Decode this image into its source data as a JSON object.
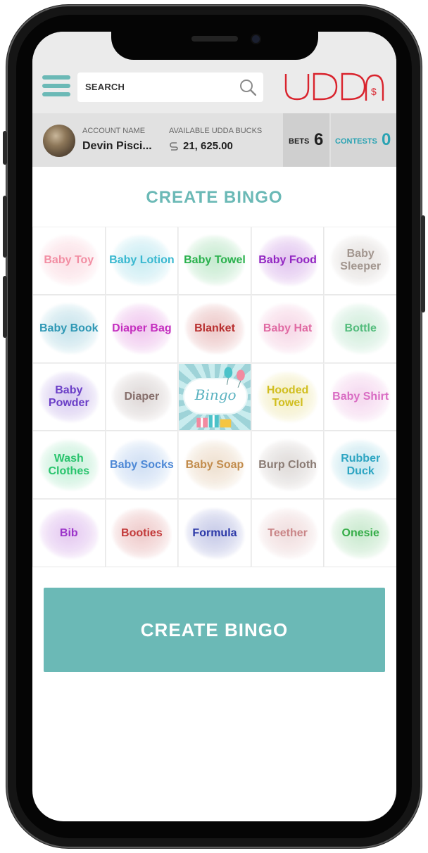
{
  "header": {
    "search_placeholder": "SEARCH",
    "logo_text": "UDDA",
    "logo_symbol": "$"
  },
  "account": {
    "name_label": "ACCOUNT NAME",
    "name": "Devin Pisci...",
    "bucks_label": "AVAILABLE UDDA BUCKS",
    "bucks_value": "21, 625.00",
    "bets_label": "BETS",
    "bets_count": "6",
    "contests_label": "CONTESTS",
    "contests_count": "0"
  },
  "page": {
    "title": "CREATE BINGO",
    "button_label": "CREATE BINGO"
  },
  "bingo": {
    "free_text": "Bingo",
    "cells": [
      {
        "label": "Baby Toy",
        "color": "#f28ea3"
      },
      {
        "label": "Baby Lotion",
        "color": "#39b8d0"
      },
      {
        "label": "Baby Towel",
        "color": "#2ab14d"
      },
      {
        "label": "Baby Food",
        "color": "#9226c2"
      },
      {
        "label": "Baby Sleeper",
        "color": "#a2968f"
      },
      {
        "label": "Baby Book",
        "color": "#2f98b5"
      },
      {
        "label": "Diaper Bag",
        "color": "#c42ebf"
      },
      {
        "label": "Blanket",
        "color": "#b82f2f"
      },
      {
        "label": "Baby Hat",
        "color": "#e06aa3"
      },
      {
        "label": "Bottle",
        "color": "#53bc7c"
      },
      {
        "label": "Baby Powder",
        "color": "#6b3fc7"
      },
      {
        "label": "Diaper",
        "color": "#866f6c"
      },
      {
        "label": "Bingo",
        "color": "#5ab2c0"
      },
      {
        "label": "Hooded Towel",
        "color": "#d1be1f"
      },
      {
        "label": "Baby Shirt",
        "color": "#d96cc3"
      },
      {
        "label": "Wash Clothes",
        "color": "#29c46d"
      },
      {
        "label": "Baby Socks",
        "color": "#4d88d6"
      },
      {
        "label": "Baby Soap",
        "color": "#c28c4c"
      },
      {
        "label": "Burp Cloth",
        "color": "#8a7b74"
      },
      {
        "label": "Rubber Duck",
        "color": "#2da5c2"
      },
      {
        "label": "Bib",
        "color": "#9b34c9"
      },
      {
        "label": "Booties",
        "color": "#c23a3a"
      },
      {
        "label": "Formula",
        "color": "#2c39a8"
      },
      {
        "label": "Teether",
        "color": "#c98587"
      },
      {
        "label": "Onesie",
        "color": "#35ad48"
      }
    ]
  }
}
